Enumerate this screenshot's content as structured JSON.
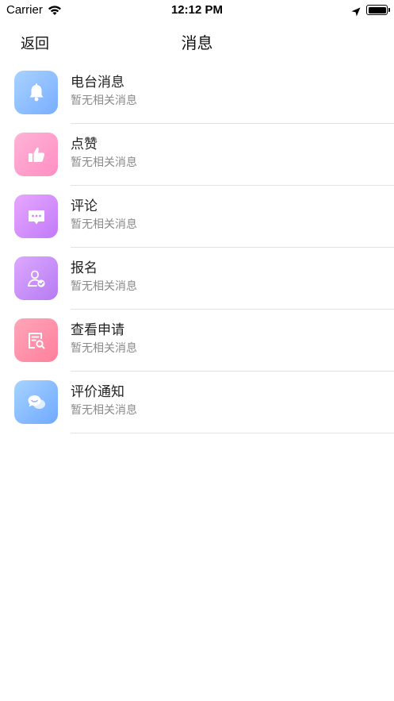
{
  "status_bar": {
    "carrier": "Carrier",
    "time": "12:12 PM"
  },
  "nav": {
    "back_label": "返回",
    "title": "消息"
  },
  "messages": [
    {
      "title": "电台消息",
      "subtitle": "暂无相关消息",
      "icon": "bell-icon",
      "color": "#8dbdff"
    },
    {
      "title": "点赞",
      "subtitle": "暂无相关消息",
      "icon": "thumbs-up-icon",
      "color": "#ff9fcb"
    },
    {
      "title": "评论",
      "subtitle": "暂无相关消息",
      "icon": "comment-icon",
      "color": "#d48dfb"
    },
    {
      "title": "报名",
      "subtitle": "暂无相关消息",
      "icon": "user-check-icon",
      "color": "#c891f8"
    },
    {
      "title": "查看申请",
      "subtitle": "暂无相关消息",
      "icon": "document-search-icon",
      "color": "#ff92aa"
    },
    {
      "title": "评价通知",
      "subtitle": "暂无相关消息",
      "icon": "chat-bubbles-icon",
      "color": "#8cbfff"
    }
  ]
}
